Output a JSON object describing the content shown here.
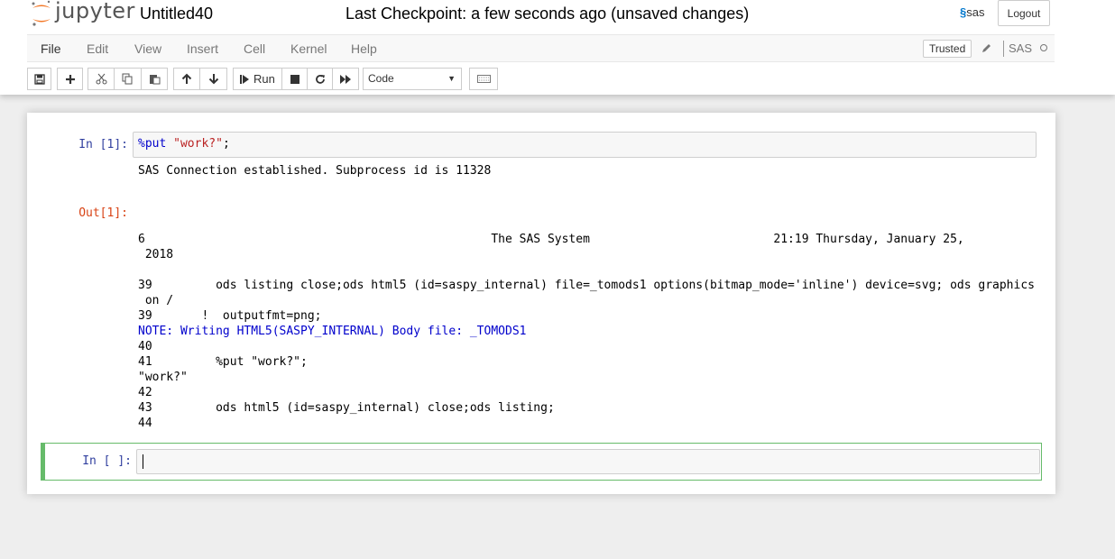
{
  "header": {
    "logo_text": "jupyter",
    "notebook_title": "Untitled40",
    "checkpoint": "Last Checkpoint: a few seconds ago  (unsaved changes)",
    "sas_logo": "sas",
    "logout_label": "Logout"
  },
  "menubar": {
    "items": [
      "File",
      "Edit",
      "View",
      "Insert",
      "Cell",
      "Kernel",
      "Help"
    ],
    "trusted_label": "Trusted",
    "kernel_name": "SAS"
  },
  "toolbar": {
    "run_label": "Run",
    "cell_type": "Code",
    "icons": [
      "save-icon",
      "plus-icon",
      "cut-icon",
      "copy-icon",
      "paste-icon",
      "arrow-up-icon",
      "arrow-down-icon",
      "step-forward-icon",
      "stop-icon",
      "restart-icon",
      "fast-forward-icon",
      "keyboard-icon"
    ]
  },
  "cells": {
    "cell1": {
      "in_prompt": "In [1]:",
      "code_kw": "%put",
      "code_str": "\"work?\"",
      "code_end": ";",
      "stream": "SAS Connection established. Subprocess id is 11328",
      "out_prompt": "Out[1]:",
      "log": [
        {
          "text": "6                                                 The SAS System                          21:19 Thursday, January 25,",
          "note": false
        },
        {
          "text": " 2018",
          "note": false
        },
        {
          "text": "",
          "note": false
        },
        {
          "text": "39         ods listing close;ods html5 (id=saspy_internal) file=_tomods1 options(bitmap_mode='inline') device=svg; ods graphics",
          "note": false
        },
        {
          "text": " on /",
          "note": false
        },
        {
          "text": "39       !  outputfmt=png;",
          "note": false
        },
        {
          "text": "NOTE: Writing HTML5(SASPY_INTERNAL) Body file: _TOMODS1",
          "note": true
        },
        {
          "text": "40",
          "note": false
        },
        {
          "text": "41         %put \"work?\";",
          "note": false
        },
        {
          "text": "\"work?\"",
          "note": false
        },
        {
          "text": "42",
          "note": false
        },
        {
          "text": "43         ods html5 (id=saspy_internal) close;ods listing;",
          "note": false
        },
        {
          "text": "44",
          "note": false
        }
      ]
    },
    "cell2": {
      "in_prompt": "In [ ]:"
    }
  },
  "colors": {
    "in_prompt": "#303f9f",
    "out_prompt": "#d84315",
    "selected_cell_border": "#66bb6a",
    "note_text": "#0000cc"
  }
}
